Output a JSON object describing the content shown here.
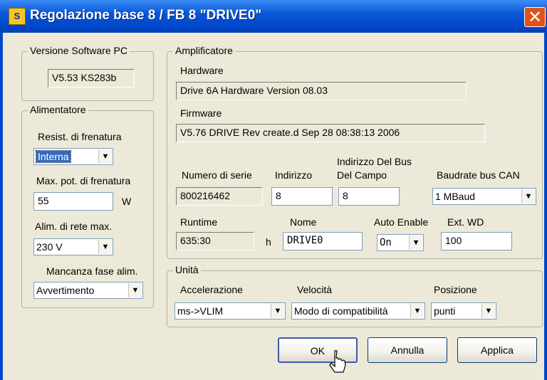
{
  "window": {
    "title": "Regolazione base 8 / FB 8 \"DRIVE0\"",
    "icon_glyph": "S",
    "close_glyph": "✕"
  },
  "software_group": {
    "legend": "Versione Software PC",
    "version": "V5.53 KS283b"
  },
  "alimentatore": {
    "legend": "Alimentatore",
    "brake_res_label": "Resist. di frenatura",
    "brake_res_value": "Interna",
    "max_power_label": "Max. pot. di frenatura",
    "max_power_value": "55",
    "max_power_unit": "W",
    "mains_label": "Alim. di rete max.",
    "mains_value": "230 V",
    "phase_loss_label": "Mancanza fase alim.",
    "phase_loss_value": "Avvertimento"
  },
  "amplificatore": {
    "legend": "Amplificatore",
    "hardware_label": "Hardware",
    "hardware_value": "Drive 6A Hardware Version 08.03",
    "firmware_label": "Firmware",
    "firmware_value": "V5.76 DRIVE Rev create.d Sep 28 08:38:13 2006",
    "serial_label": "Numero di serie",
    "serial_value": "800216462",
    "address_label": "Indirizzo",
    "address_value": "8",
    "fieldbus_label_1": "Indirizzo Del Bus",
    "fieldbus_label_2": "Del Campo",
    "fieldbus_value": "8",
    "baud_label": "Baudrate bus CAN",
    "baud_value": "1 MBaud",
    "runtime_label": "Runtime",
    "runtime_value": "635:30",
    "runtime_unit": "h",
    "name_label": "Nome",
    "name_value": "DRIVE0",
    "auto_enable_label": "Auto Enable",
    "auto_enable_value": "On",
    "ext_wd_label": "Ext. WD",
    "ext_wd_value": "100"
  },
  "unita": {
    "legend": "Unità",
    "accel_label": "Accelerazione",
    "accel_value": "ms->VLIM",
    "speed_label": "Velocità",
    "speed_value": "Modo di compatibilità",
    "position_label": "Posizione",
    "position_value": "punti"
  },
  "buttons": {
    "ok": "OK",
    "cancel": "Annulla",
    "apply": "Applica"
  },
  "icons": {
    "dropdown": "chevron-down-icon",
    "cursor": "mouse-pointer-icon"
  }
}
